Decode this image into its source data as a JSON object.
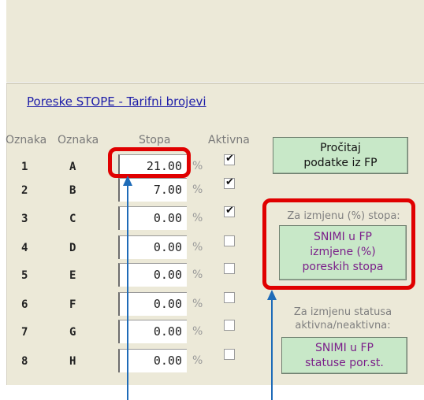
{
  "group": {
    "title": "Poreske STOPE - Tarifni brojevi"
  },
  "headers": {
    "oznaka1": "Oznaka",
    "oznaka2": "Oznaka",
    "stopa": "Stopa",
    "aktivna": "Aktivna"
  },
  "rows": [
    {
      "num": "1",
      "letter": "A",
      "rate": "21.00",
      "pct": "%",
      "active": true
    },
    {
      "num": "2",
      "letter": "B",
      "rate": "7.00",
      "pct": "%",
      "active": true
    },
    {
      "num": "3",
      "letter": "C",
      "rate": "0.00",
      "pct": "%",
      "active": true
    },
    {
      "num": "4",
      "letter": "D",
      "rate": "0.00",
      "pct": "%",
      "active": false
    },
    {
      "num": "5",
      "letter": "E",
      "rate": "0.00",
      "pct": "%",
      "active": false
    },
    {
      "num": "6",
      "letter": "F",
      "rate": "0.00",
      "pct": "%",
      "active": false
    },
    {
      "num": "7",
      "letter": "G",
      "rate": "0.00",
      "pct": "%",
      "active": false
    },
    {
      "num": "8",
      "letter": "H",
      "rate": "0.00",
      "pct": "%",
      "active": false
    }
  ],
  "read_button": {
    "line1": "Pročitaj",
    "line2": "podatke iz FP"
  },
  "rates_section": {
    "label": "Za izmjenu (%) stopa:",
    "line1": "SNIMI u FP",
    "line2": "izmjene (%)",
    "line3": "poreskih stopa"
  },
  "status_section": {
    "label1": "Za izmjenu statusa",
    "label2": "aktivna/neaktivna:",
    "line1": "SNIMI u FP",
    "line2": "statuse por.st."
  },
  "colors": {
    "button_bg": "#c8e8c8",
    "button_text_dark": "#111111",
    "button_text_purple": "#7b1f8a",
    "highlight": "#e00000",
    "arrow": "#1e6bb8",
    "panel_bg": "#ece9d8"
  }
}
